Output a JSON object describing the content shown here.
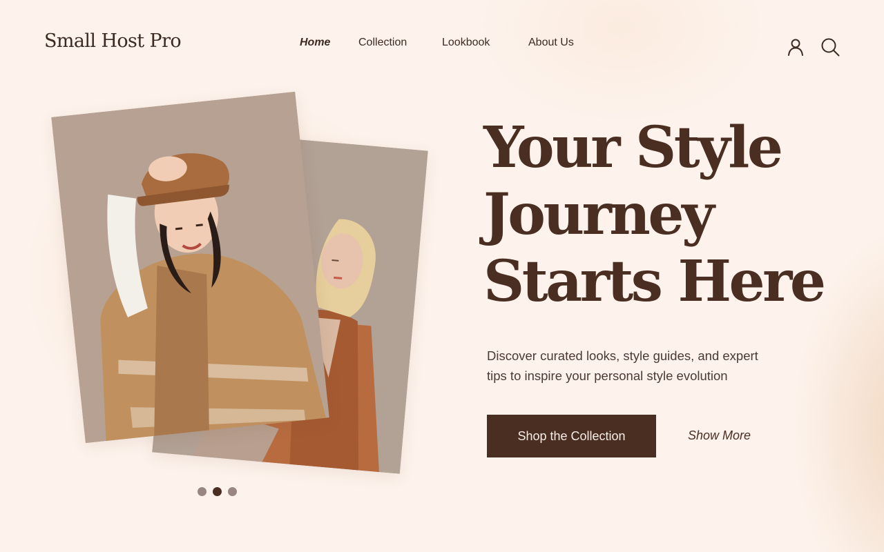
{
  "brand": {
    "name": "Small Host Pro"
  },
  "nav": {
    "items": [
      {
        "label": "Home",
        "active": true
      },
      {
        "label": "Collection",
        "active": false
      },
      {
        "label": "Lookbook",
        "active": false
      },
      {
        "label": "About Us",
        "active": false
      }
    ]
  },
  "header_icons": [
    "user-icon",
    "search-icon"
  ],
  "hero": {
    "title_lines": [
      "Your Style",
      "Journey",
      "Starts Here"
    ],
    "subtitle_lines": [
      "Discover curated looks, style guides, and expert",
      "tips to inspire your personal style evolution"
    ],
    "primary_cta": "Shop the Collection",
    "secondary_cta": "Show More"
  },
  "carousel": {
    "slides": 3,
    "active_index": 1
  },
  "colors": {
    "background": "#fdf3ec",
    "primary": "#4a2e22",
    "dot_inactive": "#9a8680",
    "button_text": "#f7eee8"
  }
}
